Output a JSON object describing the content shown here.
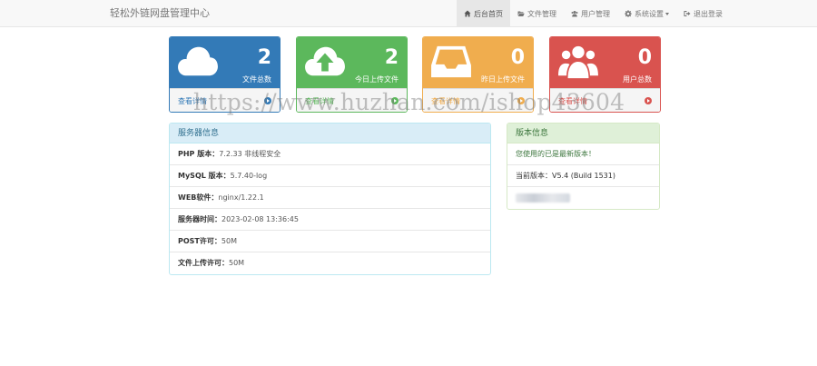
{
  "navbar": {
    "brand": "轻松外链网盘管理中心",
    "items": [
      {
        "label": "后台首页",
        "icon": "home-icon",
        "active": true
      },
      {
        "label": "文件管理",
        "icon": "folder-open-icon"
      },
      {
        "label": "用户管理",
        "icon": "users-icon"
      },
      {
        "label": "系统设置",
        "icon": "gear-icon",
        "dropdown": true
      },
      {
        "label": "退出登录",
        "icon": "sign-out-icon"
      }
    ]
  },
  "stats": [
    {
      "value": "2",
      "label": "文件总数",
      "link": "查看详情",
      "icon": "cloud-icon",
      "color": "#337ab7"
    },
    {
      "value": "2",
      "label": "今日上传文件",
      "link": "查看详情",
      "icon": "cloud-upload-icon",
      "color": "#5cb85c"
    },
    {
      "value": "0",
      "label": "昨日上传文件",
      "link": "查看详情",
      "icon": "inbox-icon",
      "color": "#f0ad4e"
    },
    {
      "value": "0",
      "label": "用户总数",
      "link": "查看详情",
      "icon": "users-icon",
      "color": "#d9534f"
    }
  ],
  "server": {
    "title": "服务器信息",
    "rows": [
      {
        "label": "PHP 版本：",
        "value": "7.2.33 非线程安全"
      },
      {
        "label": "MySQL 版本：",
        "value": "5.7.40-log"
      },
      {
        "label": "WEB软件：",
        "value": "nginx/1.22.1"
      },
      {
        "label": "服务器时间：",
        "value": "2023-02-08 13:36:45"
      },
      {
        "label": "POST许可：",
        "value": "50M"
      },
      {
        "label": "文件上传许可：",
        "value": "50M"
      }
    ]
  },
  "version": {
    "title": "版本信息",
    "latest": "您使用的已是最新版本！",
    "current": "当前版本：V5.4 (Build 1531)"
  },
  "watermark": "https://www.huzhan.com/ishop43604"
}
